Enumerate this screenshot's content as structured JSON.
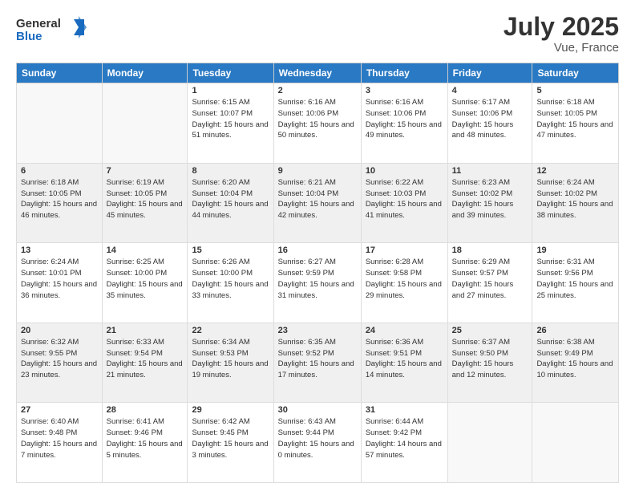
{
  "header": {
    "logo": {
      "general": "General",
      "blue": "Blue"
    },
    "title": "July 2025",
    "location": "Vue, France"
  },
  "weekdays": [
    "Sunday",
    "Monday",
    "Tuesday",
    "Wednesday",
    "Thursday",
    "Friday",
    "Saturday"
  ],
  "weeks": [
    [
      {
        "day": "",
        "empty": true
      },
      {
        "day": "",
        "empty": true
      },
      {
        "day": "1",
        "sunrise": "6:15 AM",
        "sunset": "10:07 PM",
        "daylight": "15 hours and 51 minutes."
      },
      {
        "day": "2",
        "sunrise": "6:16 AM",
        "sunset": "10:06 PM",
        "daylight": "15 hours and 50 minutes."
      },
      {
        "day": "3",
        "sunrise": "6:16 AM",
        "sunset": "10:06 PM",
        "daylight": "15 hours and 49 minutes."
      },
      {
        "day": "4",
        "sunrise": "6:17 AM",
        "sunset": "10:06 PM",
        "daylight": "15 hours and 48 minutes."
      },
      {
        "day": "5",
        "sunrise": "6:18 AM",
        "sunset": "10:05 PM",
        "daylight": "15 hours and 47 minutes."
      }
    ],
    [
      {
        "day": "6",
        "sunrise": "6:18 AM",
        "sunset": "10:05 PM",
        "daylight": "15 hours and 46 minutes."
      },
      {
        "day": "7",
        "sunrise": "6:19 AM",
        "sunset": "10:05 PM",
        "daylight": "15 hours and 45 minutes."
      },
      {
        "day": "8",
        "sunrise": "6:20 AM",
        "sunset": "10:04 PM",
        "daylight": "15 hours and 44 minutes."
      },
      {
        "day": "9",
        "sunrise": "6:21 AM",
        "sunset": "10:04 PM",
        "daylight": "15 hours and 42 minutes."
      },
      {
        "day": "10",
        "sunrise": "6:22 AM",
        "sunset": "10:03 PM",
        "daylight": "15 hours and 41 minutes."
      },
      {
        "day": "11",
        "sunrise": "6:23 AM",
        "sunset": "10:02 PM",
        "daylight": "15 hours and 39 minutes."
      },
      {
        "day": "12",
        "sunrise": "6:24 AM",
        "sunset": "10:02 PM",
        "daylight": "15 hours and 38 minutes."
      }
    ],
    [
      {
        "day": "13",
        "sunrise": "6:24 AM",
        "sunset": "10:01 PM",
        "daylight": "15 hours and 36 minutes."
      },
      {
        "day": "14",
        "sunrise": "6:25 AM",
        "sunset": "10:00 PM",
        "daylight": "15 hours and 35 minutes."
      },
      {
        "day": "15",
        "sunrise": "6:26 AM",
        "sunset": "10:00 PM",
        "daylight": "15 hours and 33 minutes."
      },
      {
        "day": "16",
        "sunrise": "6:27 AM",
        "sunset": "9:59 PM",
        "daylight": "15 hours and 31 minutes."
      },
      {
        "day": "17",
        "sunrise": "6:28 AM",
        "sunset": "9:58 PM",
        "daylight": "15 hours and 29 minutes."
      },
      {
        "day": "18",
        "sunrise": "6:29 AM",
        "sunset": "9:57 PM",
        "daylight": "15 hours and 27 minutes."
      },
      {
        "day": "19",
        "sunrise": "6:31 AM",
        "sunset": "9:56 PM",
        "daylight": "15 hours and 25 minutes."
      }
    ],
    [
      {
        "day": "20",
        "sunrise": "6:32 AM",
        "sunset": "9:55 PM",
        "daylight": "15 hours and 23 minutes."
      },
      {
        "day": "21",
        "sunrise": "6:33 AM",
        "sunset": "9:54 PM",
        "daylight": "15 hours and 21 minutes."
      },
      {
        "day": "22",
        "sunrise": "6:34 AM",
        "sunset": "9:53 PM",
        "daylight": "15 hours and 19 minutes."
      },
      {
        "day": "23",
        "sunrise": "6:35 AM",
        "sunset": "9:52 PM",
        "daylight": "15 hours and 17 minutes."
      },
      {
        "day": "24",
        "sunrise": "6:36 AM",
        "sunset": "9:51 PM",
        "daylight": "15 hours and 14 minutes."
      },
      {
        "day": "25",
        "sunrise": "6:37 AM",
        "sunset": "9:50 PM",
        "daylight": "15 hours and 12 minutes."
      },
      {
        "day": "26",
        "sunrise": "6:38 AM",
        "sunset": "9:49 PM",
        "daylight": "15 hours and 10 minutes."
      }
    ],
    [
      {
        "day": "27",
        "sunrise": "6:40 AM",
        "sunset": "9:48 PM",
        "daylight": "15 hours and 7 minutes."
      },
      {
        "day": "28",
        "sunrise": "6:41 AM",
        "sunset": "9:46 PM",
        "daylight": "15 hours and 5 minutes."
      },
      {
        "day": "29",
        "sunrise": "6:42 AM",
        "sunset": "9:45 PM",
        "daylight": "15 hours and 3 minutes."
      },
      {
        "day": "30",
        "sunrise": "6:43 AM",
        "sunset": "9:44 PM",
        "daylight": "15 hours and 0 minutes."
      },
      {
        "day": "31",
        "sunrise": "6:44 AM",
        "sunset": "9:42 PM",
        "daylight": "14 hours and 57 minutes."
      },
      {
        "day": "",
        "empty": true
      },
      {
        "day": "",
        "empty": true
      }
    ]
  ]
}
